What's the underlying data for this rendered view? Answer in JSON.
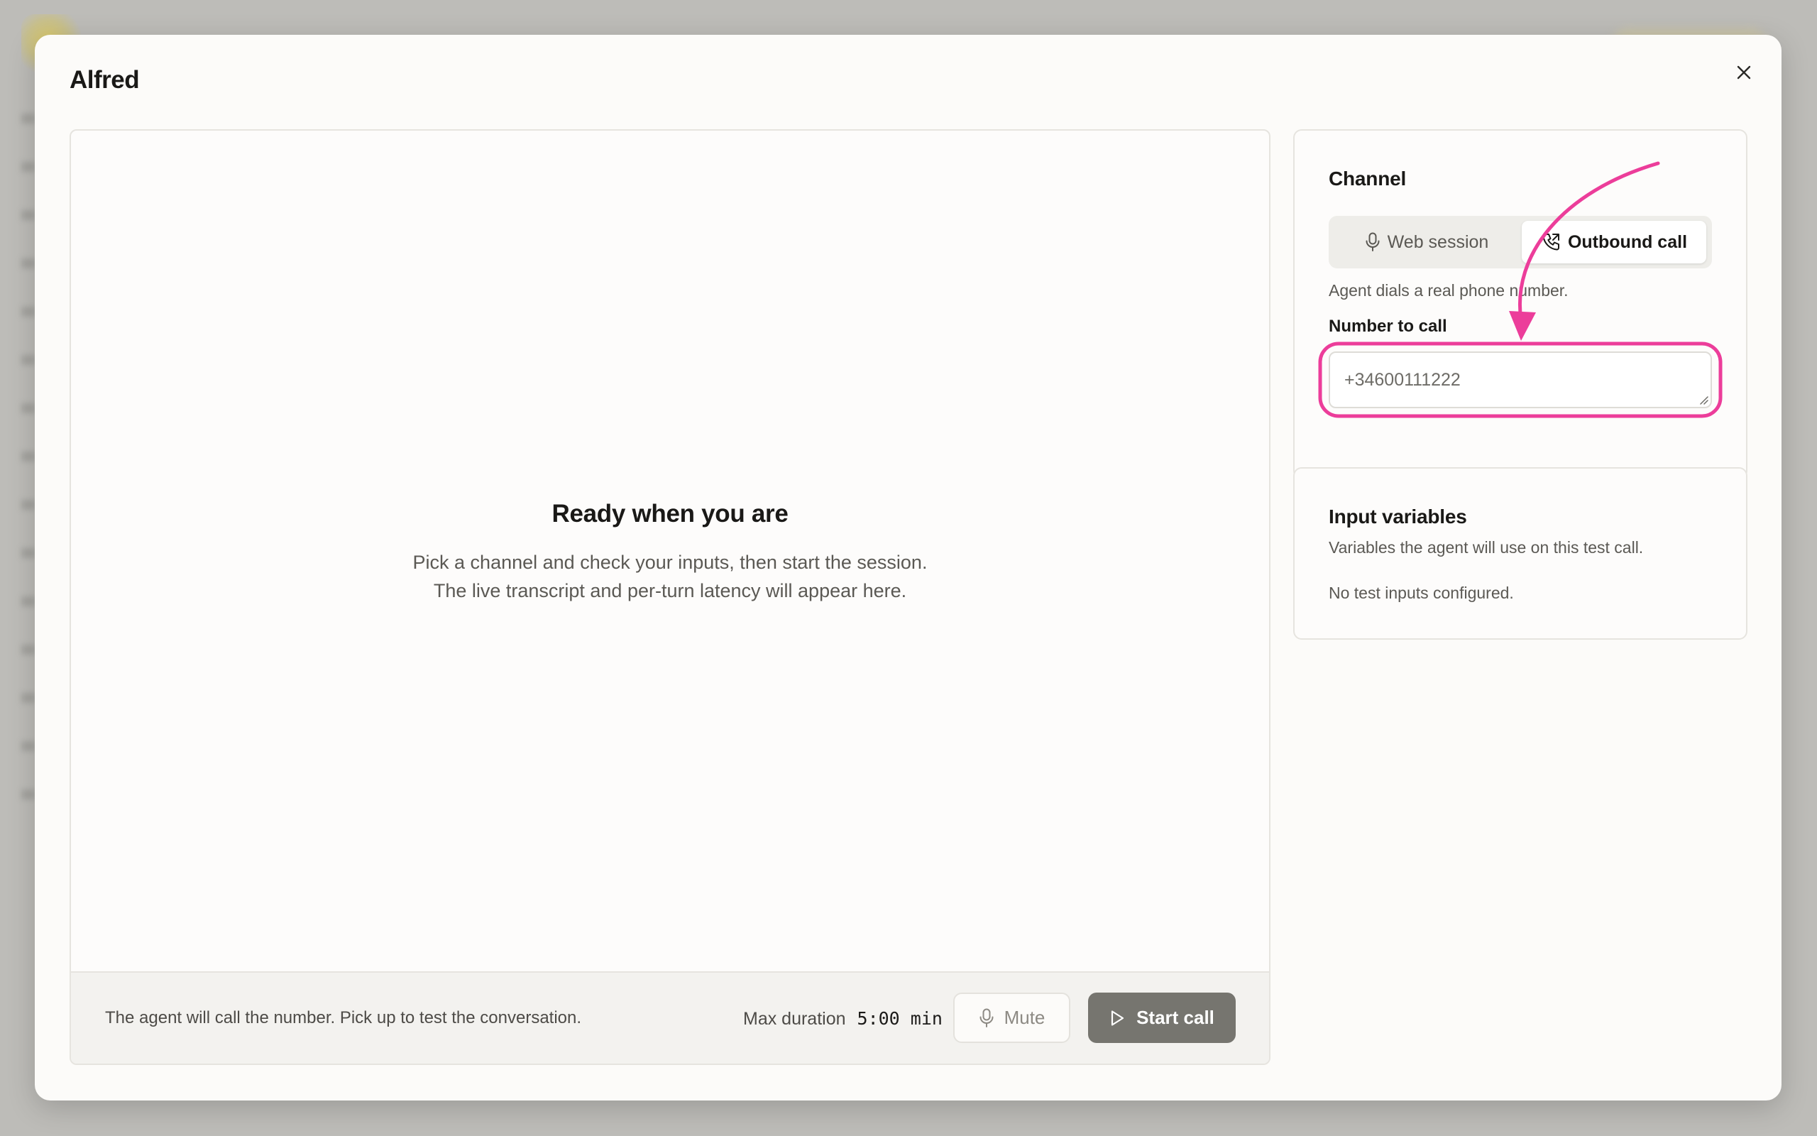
{
  "modal": {
    "title": "Alfred"
  },
  "stage": {
    "empty_title": "Ready when you are",
    "empty_line_1": "Pick a channel and check your inputs, then start the session.",
    "empty_line_2": "The live transcript and per-turn latency will appear here."
  },
  "footer": {
    "note": "The agent will call the number. Pick up to test the conversation.",
    "max_duration_label": "Max duration",
    "max_duration_value": "5:00 min",
    "mute_label": "Mute",
    "start_label": "Start call"
  },
  "channel": {
    "heading": "Channel",
    "options": [
      {
        "label": "Web session",
        "icon": "microphone-icon",
        "selected": false
      },
      {
        "label": "Outbound call",
        "icon": "phone-outgoing-icon",
        "selected": true
      }
    ],
    "description": "Agent dials a real phone number.",
    "number_label": "Number to call",
    "number_placeholder": "+34600111222"
  },
  "variables": {
    "heading": "Input variables",
    "description": "Variables the agent will use on this test call.",
    "empty": "No test inputs configured."
  },
  "colors": {
    "accent_annotation": "#ec3d9a",
    "start_button": "#76756f",
    "backdrop": "#bdbcb8"
  }
}
